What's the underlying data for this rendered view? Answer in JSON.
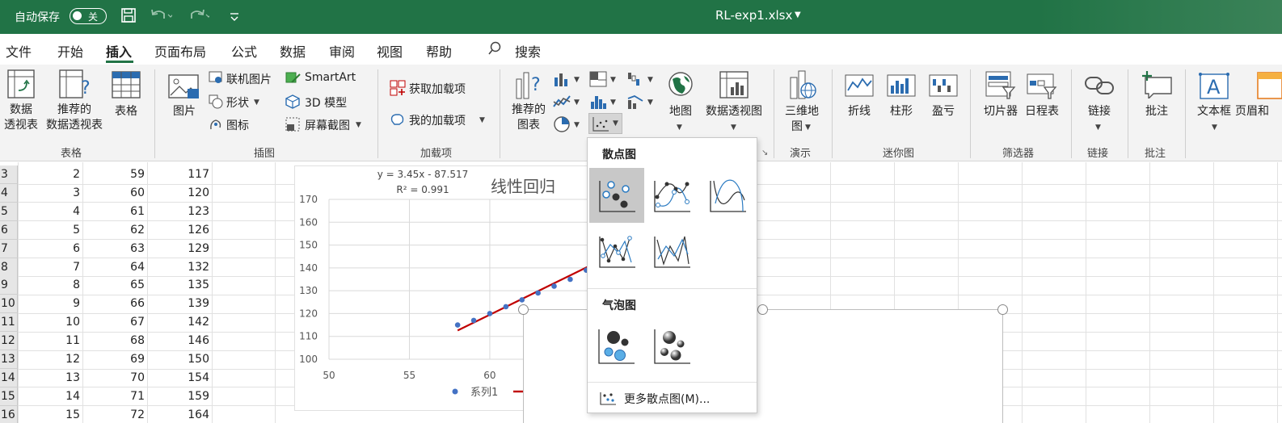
{
  "titlebar": {
    "autosave_label": "自动保存",
    "toggle_label": "关",
    "filename": "RL-exp1.xlsx"
  },
  "tabs": [
    "文件",
    "开始",
    "插入",
    "页面布局",
    "公式",
    "数据",
    "审阅",
    "视图",
    "帮助"
  ],
  "active_tab": "插入",
  "search_label": "搜索",
  "ribbon": {
    "pivot_table": "数据\n透视表",
    "pivot_table_l1": "数据",
    "pivot_table_l2": "透视表",
    "recommended_pivot_l1": "推荐的",
    "recommended_pivot_l2": "数据透视表",
    "table": "表格",
    "group_table": "表格",
    "picture": "图片",
    "online_picture": "联机图片",
    "shapes": "形状",
    "icons": "图标",
    "smartart": "SmartArt",
    "model_3d": "3D 模型",
    "screenshot": "屏幕截图",
    "group_illustrations": "插图",
    "get_addins": "获取加载项",
    "my_addins": "我的加载项",
    "group_addins": "加载项",
    "recommended_charts_l1": "推荐的",
    "recommended_charts_l2": "图表",
    "maps": "地图",
    "pivot_chart": "数据透视图",
    "map_3d_l1": "三维地",
    "map_3d_l2": "图",
    "group_tours": "演示",
    "spark_line": "折线",
    "spark_column": "柱形",
    "spark_winloss": "盈亏",
    "group_sparklines": "迷你图",
    "slicer": "切片器",
    "timeline": "日程表",
    "group_filters": "筛选器",
    "link": "链接",
    "group_links": "链接",
    "comment": "批注",
    "group_comments": "批注",
    "textbox": "文本框",
    "header_footer": "页眉和"
  },
  "rows": [
    {
      "row": "3",
      "a": "2",
      "b": "59",
      "c": "117"
    },
    {
      "row": "4",
      "a": "3",
      "b": "60",
      "c": "120"
    },
    {
      "row": "5",
      "a": "4",
      "b": "61",
      "c": "123"
    },
    {
      "row": "6",
      "a": "5",
      "b": "62",
      "c": "126"
    },
    {
      "row": "7",
      "a": "6",
      "b": "63",
      "c": "129"
    },
    {
      "row": "8",
      "a": "7",
      "b": "64",
      "c": "132"
    },
    {
      "row": "9",
      "a": "8",
      "b": "65",
      "c": "135"
    },
    {
      "row": "10",
      "a": "9",
      "b": "66",
      "c": "139"
    },
    {
      "row": "11",
      "a": "10",
      "b": "67",
      "c": "142"
    },
    {
      "row": "12",
      "a": "11",
      "b": "68",
      "c": "146"
    },
    {
      "row": "13",
      "a": "12",
      "b": "69",
      "c": "150"
    },
    {
      "row": "14",
      "a": "13",
      "b": "70",
      "c": "154"
    },
    {
      "row": "15",
      "a": "14",
      "b": "71",
      "c": "159"
    },
    {
      "row": "16",
      "a": "15",
      "b": "72",
      "c": "164"
    }
  ],
  "chart_data": {
    "type": "scatter",
    "title": "线性回归",
    "equation": "y = 3.45x - 87.517",
    "r_squared": "R² = 0.991",
    "x_ticks": [
      "50",
      "55",
      "60"
    ],
    "y_ticks": [
      "170",
      "160",
      "150",
      "140",
      "130",
      "120",
      "110",
      "100"
    ],
    "xlim": [
      50,
      69
    ],
    "ylim": [
      100,
      170
    ],
    "legend": "系列1",
    "series": [
      {
        "name": "系列1",
        "x": [
          58,
          59,
          60,
          61,
          62,
          63,
          64,
          65,
          66,
          67
        ],
        "y": [
          115,
          117,
          120,
          123,
          126,
          129,
          132,
          135,
          139,
          142
        ]
      }
    ],
    "trendline": {
      "slope": 3.45,
      "intercept": -87.517,
      "x_range": [
        58,
        67
      ],
      "color": "#c00000"
    },
    "point_color": "#4472c4"
  },
  "dropdown": {
    "scatter_title": "散点图",
    "bubble_title": "气泡图",
    "more_label": "更多散点图(M)..."
  },
  "colors": {
    "excel_green": "#217346",
    "ribbon_bg": "#f3f3f3",
    "point_blue": "#4472c4",
    "trend_red": "#c00000"
  }
}
